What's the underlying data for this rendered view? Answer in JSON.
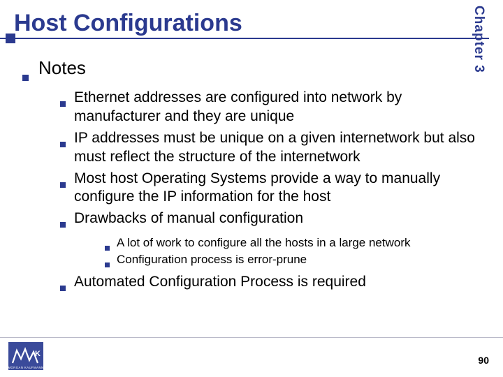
{
  "chapter_tab": "Chapter 3",
  "title": "Host Configurations",
  "page_number": "90",
  "logo_alt": "MK Morgan Kaufmann",
  "lvl1": {
    "label": "Notes"
  },
  "lvl2": [
    {
      "text": "Ethernet addresses are configured into network by manufacturer and they are unique"
    },
    {
      "text": "IP addresses must be unique on a given internetwork but also must reflect the structure of the internetwork"
    },
    {
      "text": "Most host Operating Systems provide a way to manually configure the IP information for the host"
    },
    {
      "text": "Drawbacks of manual configuration"
    },
    {
      "text": "Automated Configuration Process is required"
    }
  ],
  "lvl3": [
    {
      "text": "A lot of work to configure all the hosts in a large network"
    },
    {
      "text": "Configuration process is error-prune"
    }
  ]
}
